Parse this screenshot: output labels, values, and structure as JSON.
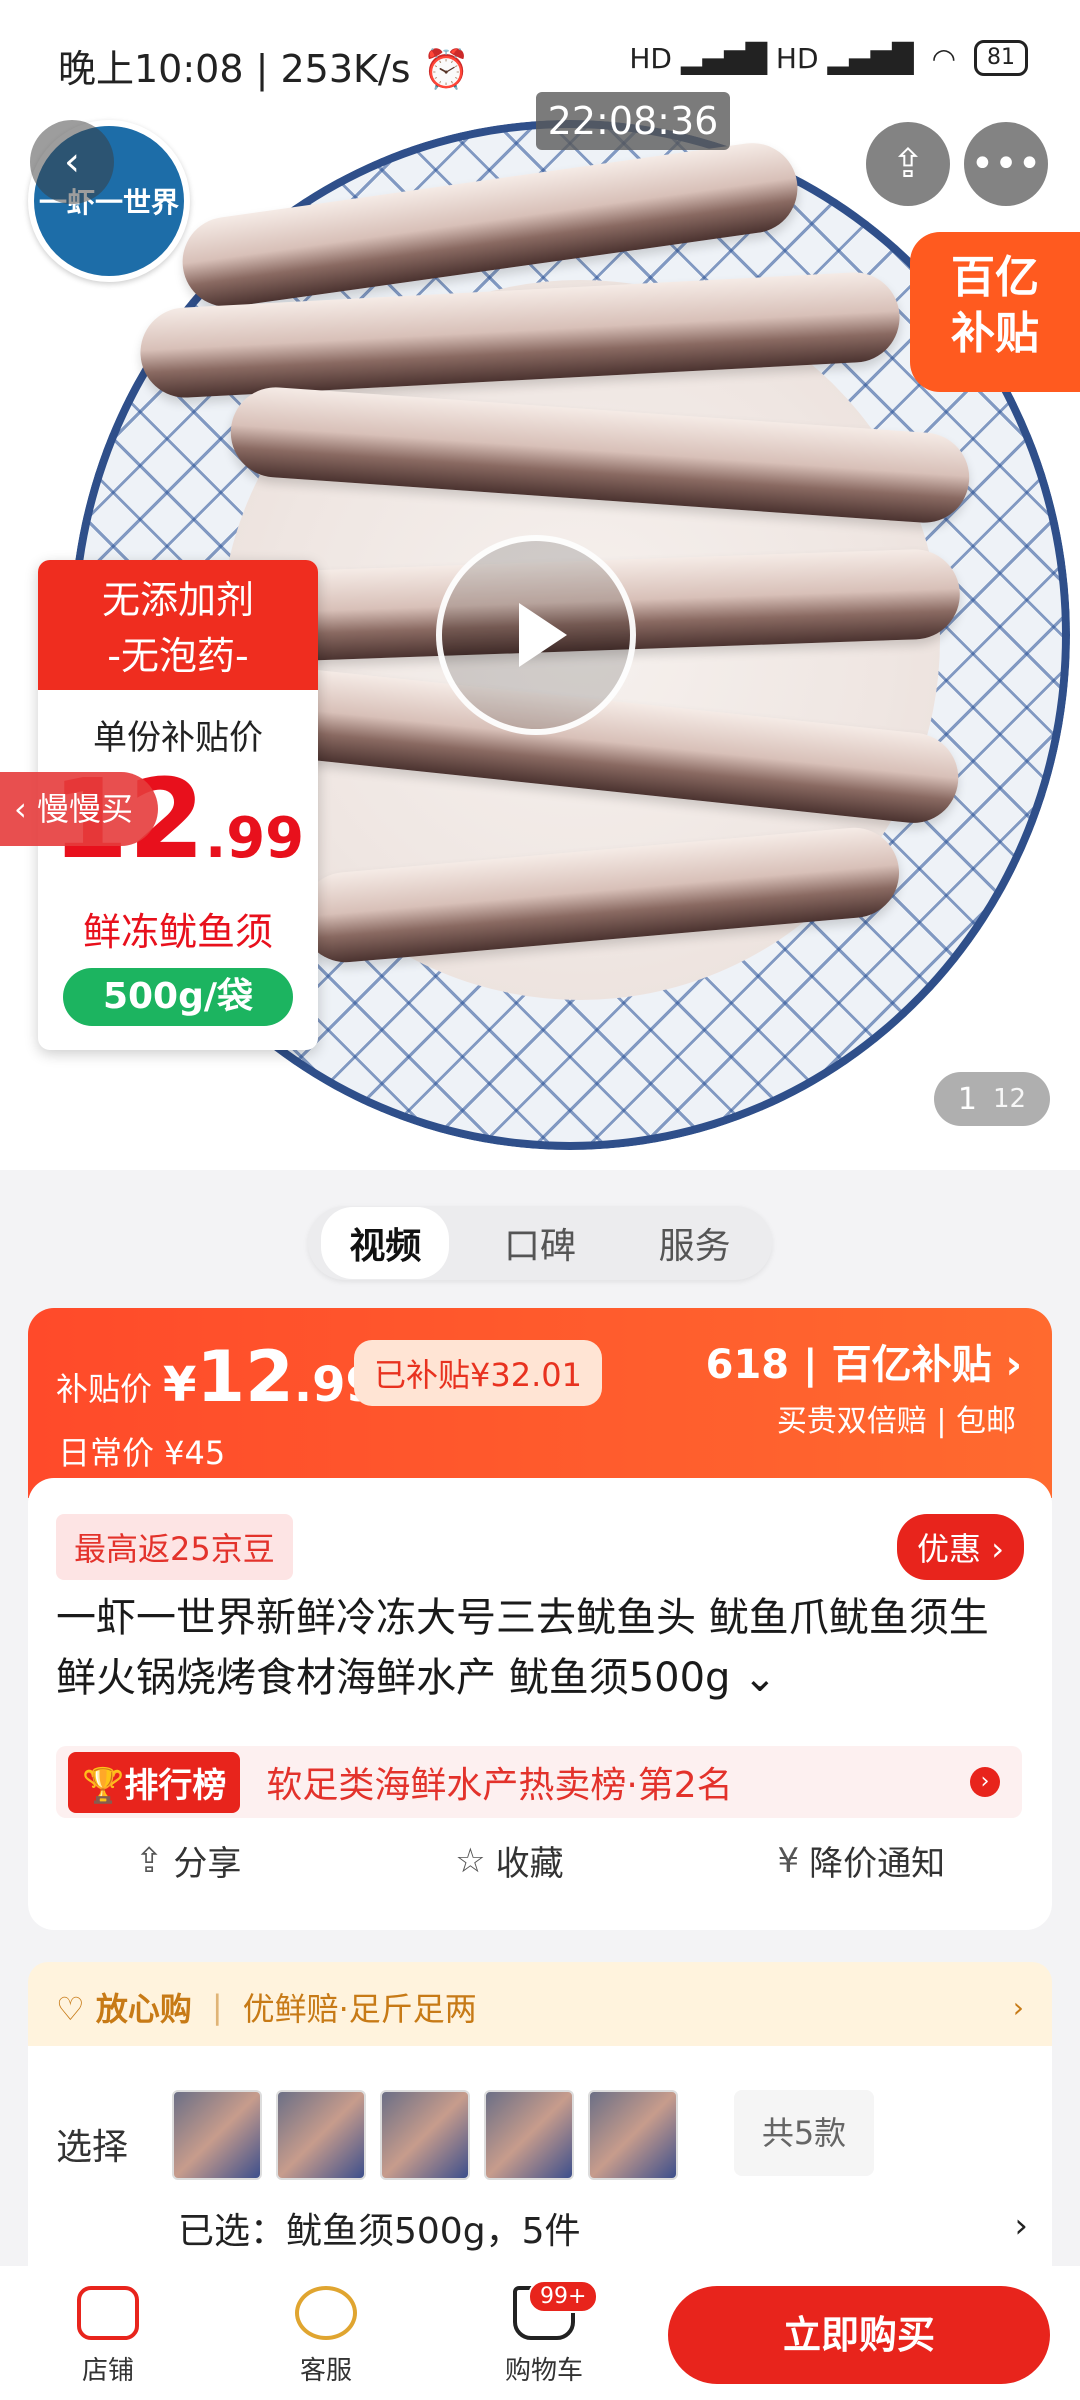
{
  "status_bar": {
    "time": "晚上10:08 | 253K/s ⏰",
    "signals": "HD ▂▄▆█ HD ▂▄▆█",
    "battery": "81"
  },
  "timestamp": "22:08:36",
  "logo_text": "一虾一世界",
  "subsidy_badge": "百亿\n补贴",
  "price_card": {
    "head": "无添加剂\n-无泡药-",
    "label": "单份补贴价",
    "price_int": "12",
    "price_dec": ".99",
    "name": "鲜冻鱿鱼须",
    "pill": "500g/袋"
  },
  "slow_buy": "‹ 慢慢买",
  "page_indicator": {
    "current": "1",
    "total": "12"
  },
  "tabs": [
    "视频",
    "口碑",
    "服务"
  ],
  "banner": {
    "sub_label": "补贴价",
    "currency": "¥",
    "price_int": "12",
    "price_dec": ".99",
    "saved": "已补贴¥32.01",
    "daily": "日常价 ¥45",
    "brand": "618 | 百亿补贴 ›",
    "brand_sub": "买贵双倍赔 | 包邮"
  },
  "product": {
    "jd_beans": "最高返25京豆",
    "offer": "优惠 ›",
    "title": "一虾一世界新鲜冷冻大号三去鱿鱼头 鱿鱼爪鱿鱼须生鲜火锅烧烤食材海鲜水产 鱿鱼须500g ⌄",
    "rank_tag": "🏆排行榜",
    "rank_text": "软足类海鲜水产热卖榜·第2名",
    "actions": [
      {
        "icon": "share-icon",
        "glyph": "⇪",
        "label": "分享"
      },
      {
        "icon": "star-icon",
        "glyph": "☆",
        "label": "收藏"
      },
      {
        "icon": "price-drop-icon",
        "glyph": "¥",
        "label": "降价通知"
      }
    ]
  },
  "assurance": {
    "left": "♡ 放心购",
    "right": "优鲜赔·足斤足两",
    "chev": "›"
  },
  "selection": {
    "label": "选择",
    "count": "共5款",
    "selected": "已选：鱿鱼须500g，5件",
    "chev": "›"
  },
  "bottom_nav": {
    "shop": "店铺",
    "service": "客服",
    "cart": "购物车",
    "cart_badge": "99+",
    "buy": "立即购买"
  },
  "colors": {
    "accent": "#e8241c",
    "banner_orange": "#ff5a1f",
    "assure_gold": "#c77a16",
    "green": "#1cb460"
  }
}
